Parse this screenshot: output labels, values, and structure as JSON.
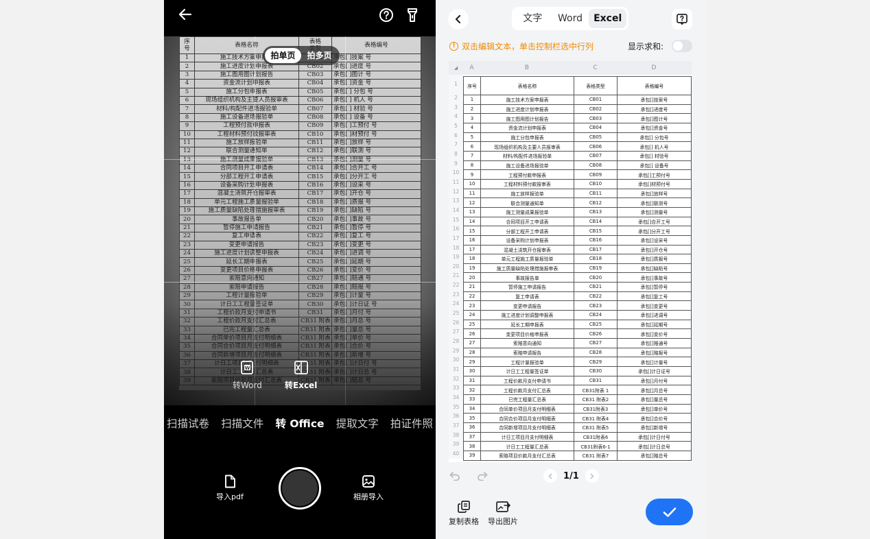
{
  "camera": {
    "capture_modes": [
      "拍单页",
      "拍多页"
    ],
    "capture_mode_selected": "拍单页",
    "convert_options": [
      {
        "label": "转Word",
        "icon": "word-doc-icon"
      },
      {
        "label": "转Excel",
        "icon": "excel-doc-icon"
      }
    ],
    "mode_tabs": [
      "扫描试卷",
      "扫描文件",
      "转 Office",
      "提取文字",
      "拍证件照"
    ],
    "active_mode": "转 Office",
    "bottom": {
      "import_pdf": "导入pdf",
      "album_import": "相册导入"
    },
    "paper": {
      "header": [
        "序号",
        "表格名称",
        "表格\n类型",
        "表格编号"
      ],
      "rows": [
        [
          "1",
          "施工技术方案申报表",
          "CB01",
          "承包[  ]技案    号"
        ],
        [
          "2",
          "施工进度计划申报表",
          "CB02",
          "承包[  ]进度    号"
        ],
        [
          "3",
          "施工图用图计划报告",
          "CB03",
          "承包[  ]图计    号"
        ],
        [
          "4",
          "资金流计划申报表",
          "CB04",
          "承包[  ]资金    号"
        ],
        [
          "5",
          "施工分包申报表",
          "CB05",
          "承包[  ] 分包   号"
        ],
        [
          "6",
          "现场组织机构及主要人员报审表",
          "CB06",
          "承包[  ] 机人   号"
        ],
        [
          "7",
          "材料/构配件进场报验单",
          "CB07",
          "承包[  ] 材验   号"
        ],
        [
          "8",
          "施工设备进场报验单",
          "CB08",
          "承包[  ] 设备   号"
        ],
        [
          "9",
          "工程预付款申报表",
          "CB09",
          "承包[  ]工预付   号"
        ],
        [
          "10",
          "工程材料预付款报审表",
          "CB10",
          "承包[  ]材预付   号"
        ],
        [
          "11",
          "施工放样报验单",
          "CB11",
          "承包[  ]放样    号"
        ],
        [
          "12",
          "联合测量通知单",
          "CB12",
          "承包[  ]联测    号"
        ],
        [
          "13",
          "施工测量成果报验单",
          "CB13",
          "承包[  ]测量    号"
        ],
        [
          "14",
          "合同项目开工申请表",
          "CB14",
          "承包[  ]合开工   号"
        ],
        [
          "15",
          "分部工程开工申请表",
          "CB15",
          "承包[  ]分开工   号"
        ],
        [
          "16",
          "设备采购计划申报表",
          "CB16",
          "承包[  ]设采    号"
        ],
        [
          "17",
          "混凝土浇筑开仓报审表",
          "CB17",
          "承包[  ]开仓    号"
        ],
        [
          "18",
          "单元工程施工质量报验单",
          "CB18",
          "承包[  ]质报    号"
        ],
        [
          "19",
          "施工质量缺陷处理措施报审表",
          "CB19",
          "承包[  ]缺陷    号"
        ],
        [
          "20",
          "事故报告单",
          "CB20",
          "承包[  ]事故    号"
        ],
        [
          "21",
          "暂停施工申请报告",
          "CB21",
          "承包[  ]暂停    号"
        ],
        [
          "22",
          "复工申请表",
          "CB22",
          "承包[  ]复工    号"
        ],
        [
          "23",
          "变更申请报告",
          "CB23",
          "承包[  ]变更    号"
        ],
        [
          "24",
          "施工进度计划调整申报表",
          "CB24",
          "承包[  ]进调    号"
        ],
        [
          "25",
          "延长工期申报表",
          "CB25",
          "承包[  ]延期    号"
        ],
        [
          "26",
          "变更项目价格申报表",
          "CB26",
          "承包[  ]变价    号"
        ],
        [
          "27",
          "索赔意向通知",
          "CB27",
          "承包[  ]赔通    号"
        ],
        [
          "28",
          "索赔申请报告",
          "CB28",
          "承包[  ]赔报    号"
        ],
        [
          "29",
          "工程计量报验单",
          "CB29",
          "承包[  ]计量    号"
        ],
        [
          "30",
          "计日工工程量签证单",
          "CB30",
          "承包[  ]计日证   号"
        ],
        [
          "31",
          "工程价款月支付申请书",
          "CB31",
          "承包[  ]月付    号"
        ],
        [
          "32",
          "工程价款月支付汇总表",
          "CB31 附表 1",
          "承包[  ]月总    号"
        ],
        [
          "33",
          "已完工程量汇总表",
          "CB31 附表 2",
          "承包[  ]量总    号"
        ],
        [
          "34",
          "合同单价项目月支付明细表",
          "CB31 附表 3",
          "承包[  ]单价    号"
        ],
        [
          "35",
          "合同合价项目月支付明细表",
          "CB31 附表 4",
          "承包[  ]合价    号"
        ],
        [
          "36",
          "合同新增项目月支付明细表",
          "CB31 附表 5",
          "承包[  ]新增    号"
        ],
        [
          "37",
          "计日工项目月支付明细表",
          "CB31 附表 6",
          "承包[  ]计日付   号"
        ],
        [
          "38",
          "计日工工程量汇总表",
          "CB31 附表6-1",
          "承包[  ]计日总   号"
        ],
        [
          "39",
          "索赔项目价款月支付汇总表",
          "CB31 附表 7",
          "承包[  ]赔总    号"
        ]
      ]
    }
  },
  "result": {
    "tabs": [
      "文字",
      "Word",
      "Excel"
    ],
    "active_tab": "Excel",
    "tip": "双击编辑文本，单击控制栏选中行列",
    "show_sum_label": "显示求和:",
    "show_sum_on": false,
    "columns": [
      "A",
      "B",
      "C",
      "D"
    ],
    "header": [
      "序号",
      "表格名称",
      "表格类型",
      "表格编号"
    ],
    "rows": [
      [
        "1",
        "施工技术方案申报表",
        "CB01",
        "承包[]技案号"
      ],
      [
        "2",
        "施工进度计划申报表",
        "CB02",
        "承包[]进度号"
      ],
      [
        "3",
        "施工图用图计划报告",
        "CB03",
        "承包[]图计号"
      ],
      [
        "4",
        "资金流计划申报表",
        "CB04",
        "承包[]资金号"
      ],
      [
        "5",
        "施工分包申报表",
        "CB05",
        "承包[] 分包号"
      ],
      [
        "6",
        "现场组织机构及主要人员报审表",
        "CB06",
        "承包[] 机人号"
      ],
      [
        "7",
        "材料/构配件进场报验单",
        "CB07",
        "承包[] 材验号"
      ],
      [
        "8",
        "施工设备进场报验单",
        "CB08",
        "承包[] 设备号"
      ],
      [
        "9",
        "工程预付款申报表",
        "CB09",
        "承包[]工预付号"
      ],
      [
        "10",
        "工程材料预付款报审表",
        "CB10",
        "承包[]材预付号"
      ],
      [
        "11",
        "施工放样报验单",
        "CB11",
        "承包[]放样号"
      ],
      [
        "12",
        "联合测量通知单",
        "CB12",
        "承包[]联测号"
      ],
      [
        "13",
        "施工测量成果报验单",
        "CB13",
        "承包[]测量号"
      ],
      [
        "14",
        "合同项目开工申请表",
        "CB14",
        "承包[]合开工号"
      ],
      [
        "15",
        "分部工程开工申请表",
        "CB15",
        "承包[]分开工号"
      ],
      [
        "16",
        "设备采购计划申报表",
        "CB16",
        "承包[]设采号"
      ],
      [
        "17",
        "混凝土浇筑开仓报审表",
        "CB17",
        "承包[]开仓号"
      ],
      [
        "18",
        "单元工程施工质量报验单",
        "CB18",
        "承包[]质报号"
      ],
      [
        "19",
        "施工质量缺陷处理措施报审表",
        "CB19",
        "承包[]缺陷号"
      ],
      [
        "20",
        "事故报告单",
        "CB20",
        "承包[]事故号"
      ],
      [
        "21",
        "暂停施工申请报告",
        "CB21",
        "承包[]暂停号"
      ],
      [
        "22",
        "复工申请表",
        "CB22",
        "承包[]复工号"
      ],
      [
        "23",
        "变更申请报告",
        "CB23",
        "承包[]变更号"
      ],
      [
        "24",
        "施工进度计划调整申报表",
        "CB24",
        "承包[]进调号"
      ],
      [
        "25",
        "延长工期申报表",
        "CB25",
        "承包[]延期号"
      ],
      [
        "26",
        "变更项目价格申报表",
        "CB26",
        "承包[]变价号"
      ],
      [
        "27",
        "索赔意向通知",
        "CB27",
        "承包[]赔通号"
      ],
      [
        "28",
        "索赔申请报告",
        "CB28",
        "承包[]赔报号"
      ],
      [
        "29",
        "工程计量报验单",
        "CB29",
        "承包[]计量号"
      ],
      [
        "30",
        "计日工工程量签证单",
        "CB30",
        "承包[]计日证号"
      ],
      [
        "31",
        "工程价款月支付申请书",
        "CB31",
        "承包[]月付号"
      ],
      [
        "32",
        "工程价款月支付汇总表",
        "CB31附表 1",
        "承包[]月总号"
      ],
      [
        "33",
        "已完工程量汇总表",
        "CB31 附表2",
        "承包[]量总号"
      ],
      [
        "34",
        "合同单价项目月支付明细表",
        "CB31附表3",
        "承包[]单价号"
      ],
      [
        "35",
        "合同合价项目月支付明细表",
        "CB31 附表4",
        "承包[]合价号"
      ],
      [
        "36",
        "合同新增项目月支付明细表",
        "CB31 附表5",
        "承包[]新增号"
      ],
      [
        "37",
        "计日工项目月支付明细表",
        "CB31附表6",
        "承包[]计日付号"
      ],
      [
        "38",
        "计日工工程量汇总表",
        "CB31附表6-1",
        "承包[]计日总号"
      ],
      [
        "39",
        "索赔项目价款月支付汇总表",
        "CB31 附表7",
        "承包[]赔总号"
      ]
    ],
    "page_indicator": "1/1",
    "actions": {
      "copy_table": "复制表格",
      "export_image": "导出图片"
    },
    "accent_color": "#1e74f5",
    "tip_color": "#f08a00"
  }
}
